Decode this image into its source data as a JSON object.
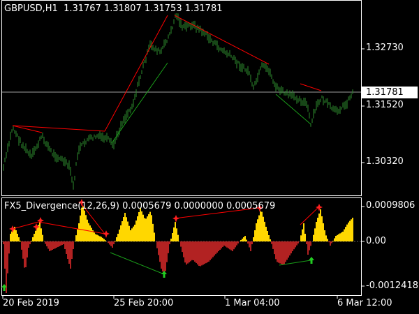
{
  "main_chart": {
    "symbol_timeframe": "GBPUSD,H1",
    "ohlc": "1.31767 1.31807 1.31753 1.31781",
    "price_axis": [
      "1.32730",
      "1.31520",
      "1.30320"
    ],
    "current_price": "1.31781"
  },
  "indicator": {
    "title": "FX5_Divergence(12,26,9)",
    "values": "0.0005679 0.0000000 0.0005679",
    "axis": [
      "0.0009806",
      "0.00",
      "-0.0012418"
    ]
  },
  "time_axis": [
    "20 Feb 2019",
    "25 Feb 20:00",
    "1 Mar 04:00",
    "6 Mar 12:00"
  ],
  "colors": {
    "background": "#000000",
    "candle": "#2e8b2e",
    "divergence_line_red": "#ff0000",
    "divergence_line_green": "#1a9e1a",
    "histogram_positive": "#ffd700",
    "histogram_negative": "#b22222",
    "frame": "#ffffff"
  },
  "icons": {
    "sell_arrow": "red-star-arrow-icon",
    "buy_arrow": "green-up-arrow-icon"
  }
}
